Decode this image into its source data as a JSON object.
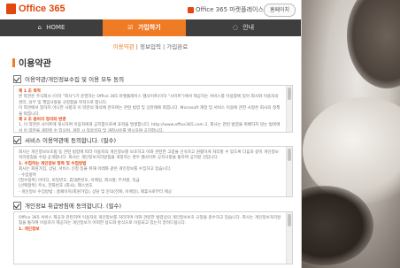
{
  "header": {
    "logo_text": "Office 365",
    "top_link": "Office 365 마켓플레이스",
    "home_button": "홈페이지"
  },
  "nav": {
    "home": "HOME",
    "signup": "가입하기",
    "guide": "안내"
  },
  "subnav": {
    "terms": "이용약관",
    "info": "정보입력",
    "done": "가입완료",
    "sep1": " | ",
    "sep2": " | "
  },
  "page": {
    "title": "이용약관"
  },
  "agreements": [
    {
      "label": "이용약관/개인정보수집 및 이용 모두 동의",
      "box_lines": [
        {
          "text": "제 1 조 목적",
          "h": true
        },
        {
          "text": "본 약관은 주식회사 (이하 \"회사\")가 운영하는 Office 365 마켓플레이스 웹사이트(이하 \"사이트\")에서 제공하는 서비스를 이용함에 있어 회사와 이용자의 권리, 의무 및 책임사항을 규정함을 목적으로 합니다."
        },
        {
          "text": "이 약관에서 정하지 아니한 사항과 이 약관의 해석에 관하여는 관련 법령 및 상관례에 따릅니다. Microsoft 계정 및 서비스 이용에 관한 사항은 회사의 정책을 따릅니다."
        },
        {
          "text": "제 2 조 용어의 정의와 변경",
          "h": true
        },
        {
          "text": "1. 이 약관은 사이트에 게시하여 이용자에게 공지함으로써 효력을 발생합니다. http://www.office365.com 2. 회사는 관련 법령을 위배하지 않는 범위에서 이 약관을 개정할 수 있으며, 개정 시 적용일자 및 개정사유를 명시하여 공지합니다."
        }
      ]
    },
    {
      "label": "서비스 이용약관에 동의합니다. (필수)",
      "box_lines": [
        {
          "text": "회사는 개인정보보호법 등 관련 법령에 따라 이용자의 개인정보를 보호하고 이와 관련한 고충을 신속하고 원활하게 처리할 수 있도록 다음과 같이 개인정보 처리방침을 수립·공개합니다. 회사는 개인정보처리방침을 개정하는 경우 웹사이트 공지사항을 통하여 공지할 것입니다."
        },
        {
          "text": "1. 수집하는 개인정보 항목 및 수집방법",
          "h": true
        },
        {
          "text": "회사는 회원가입, 상담, 서비스 신청 등을 위해 아래와 같은 개인정보를 수집하고 있습니다."
        },
        {
          "text": "- 수집항목"
        },
        {
          "text": "[필수항목] 아이디, 비밀번호, 휴대폰번호, 이메일, 회사명, 부서명, 직급"
        },
        {
          "text": "[선택항목] 주소, 전화번호 (회사), 팩스번호"
        },
        {
          "text": "- 개인정보 수집방법 : 홈페이지(회원가입), 상담 및 문의(전화, 이메일), 제휴사로부터 제공"
        }
      ]
    },
    {
      "label": "개인정보 취급방침에 동의합니다. (필수)",
      "box_lines": [
        {
          "text": "Office 365 서비스 제공과 관련하여 이용자의 개인정보를 처리하며 이와 관련한 법령상의 개인정보보호 규정을 준수하고 있습니다. 회사는 개인정보처리방침을 통하여 이용자가 제공하는 개인정보가 어떠한 용도와 방식으로 이용되고 있는지 알려드립니다."
        },
        {
          "text": "1. 개인정보",
          "h": true
        }
      ]
    }
  ]
}
